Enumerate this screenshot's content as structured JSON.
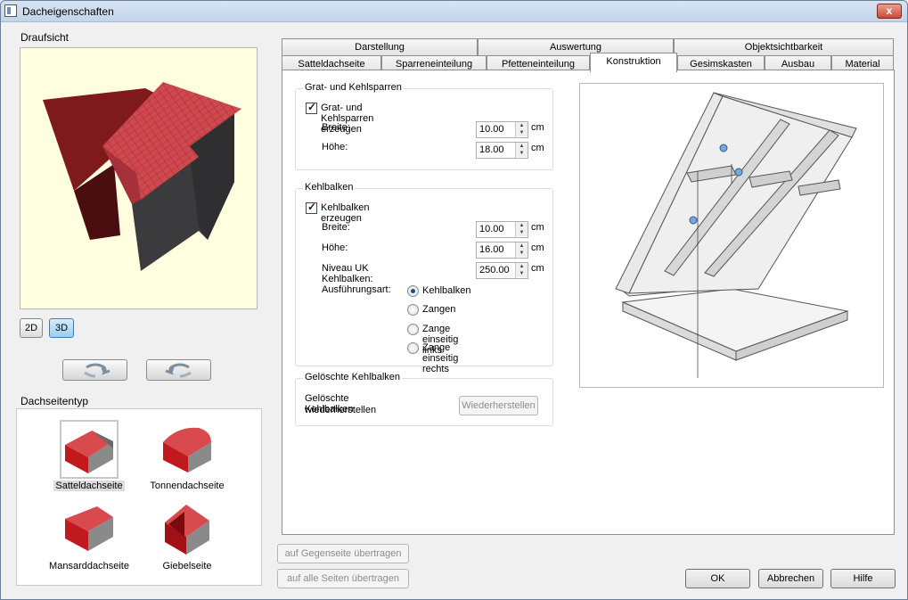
{
  "window": {
    "title": "Dacheigenschaften",
    "close_glyph": "x"
  },
  "left": {
    "draufsicht_label": "Draufsicht",
    "view_2d": "2D",
    "view_3d": "3D",
    "rotate_left_icon": "rotate-left-icon",
    "rotate_right_icon": "rotate-right-icon",
    "dachseitentyp_label": "Dachseitentyp",
    "roof_types": [
      {
        "label": "Satteldachseite",
        "selected": true
      },
      {
        "label": "Tonnendachseite",
        "selected": false
      },
      {
        "label": "Mansarddachseite",
        "selected": false
      },
      {
        "label": "Giebelseite",
        "selected": false
      }
    ]
  },
  "tabs": {
    "row1": [
      "Darstellung",
      "Auswertung",
      "Objektsichtbarkeit"
    ],
    "row2": [
      "Satteldachseite",
      "Sparreneinteilung",
      "Pfetteneinteilung",
      "Konstruktion",
      "Gesimskasten",
      "Ausbau",
      "Material"
    ],
    "active": "Konstruktion"
  },
  "grat": {
    "title": "Grat- und Kehlsparren",
    "checkbox_label": "Grat- und Kehlsparren erzeugen",
    "checked": true,
    "breite_label": "Breite:",
    "breite_value": "10.00",
    "hoehe_label": "Höhe:",
    "hoehe_value": "18.00",
    "unit": "cm"
  },
  "kehl": {
    "title": "Kehlbalken",
    "checkbox_label": "Kehlbalken erzeugen",
    "checked": true,
    "breite_label": "Breite:",
    "breite_value": "10.00",
    "hoehe_label": "Höhe:",
    "hoehe_value": "16.00",
    "niveau_label": "Niveau UK Kehlbalken:",
    "niveau_value": "250.00",
    "unit": "cm",
    "ausfuehrung_label": "Ausführungsart:",
    "options": [
      "Kehlbalken",
      "Zangen",
      "Zange einseitig links",
      "Zange einseitig rechts"
    ],
    "selected": "Kehlbalken"
  },
  "geloescht": {
    "title": "Gelöschte Kehlbalken",
    "text_line1": "Gelöschte Kehlbalken",
    "text_line2": "wiederherstellen",
    "button": "Wiederherstellen"
  },
  "bottom": {
    "transfer_opposite": "auf Gegenseite übertragen",
    "transfer_all": "auf alle Seiten übertragen",
    "ok": "OK",
    "cancel": "Abbrechen",
    "help": "Hilfe"
  },
  "colors": {
    "roof_red": "#c8393e",
    "wall_dark": "#3a3a3a",
    "preview_bg": "#ffffe0"
  }
}
